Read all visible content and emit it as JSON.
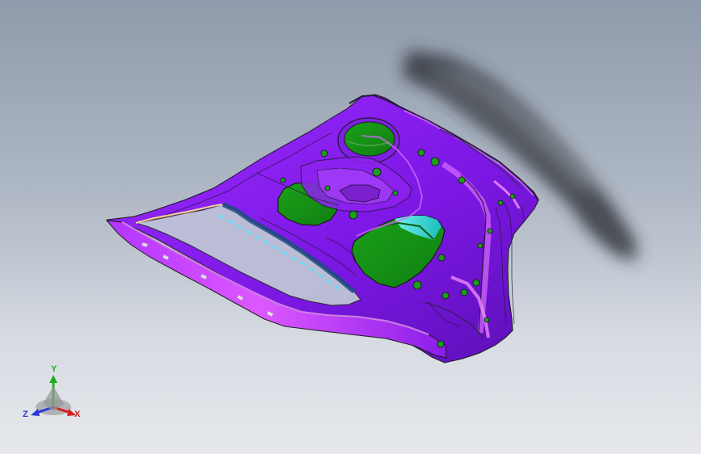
{
  "viewport": {
    "background_top": "#8f9aab",
    "background_bottom": "#e6e8ec"
  },
  "model": {
    "part_color": "#8a1cf0",
    "part_highlight": "#c040ff",
    "cutout_color": "#119911",
    "accent_color": "#37d6df",
    "shadow_color": "#2b2f36"
  },
  "triad": {
    "x_label": "X",
    "y_label": "Y",
    "z_label": "Z",
    "x_color": "#d62020",
    "y_color": "#1fae1f",
    "z_color": "#2b39d6"
  }
}
